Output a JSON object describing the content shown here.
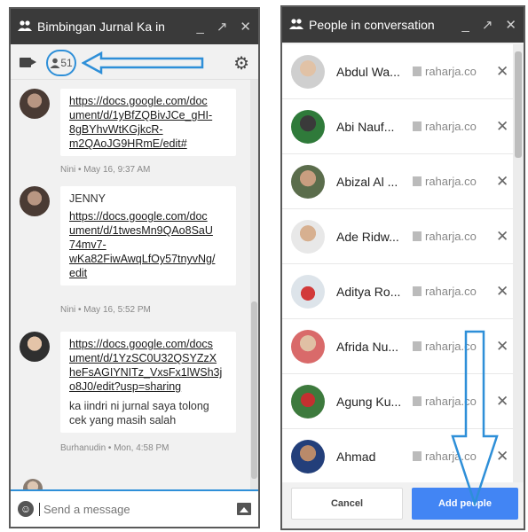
{
  "colors": {
    "titlebar": "#3a3a3a",
    "accent": "#2e8fd8",
    "add_button": "#4285f4"
  },
  "chat": {
    "title": "Bimbingan Jurnal Ka in",
    "people_count": "51",
    "messages": [
      {
        "lines": [
          "https://docs.google.com/doc",
          "ument/d/1yBfZQBivJCe_gHI-",
          "8gBYhvWtKGjkcR-",
          "m2QAoJG9HRmE/edit#"
        ],
        "meta": "Nini • May 16, 9:37 AM"
      },
      {
        "sender": "JENNY",
        "lines": [
          "https://docs.google.com/doc",
          "ument/d/1twesMn9QAo8SaU",
          "74mv7-",
          "wKa82FiwAwqLfOy57tnyvNg/",
          "edit"
        ],
        "meta": "Nini • May 16, 5:52 PM"
      },
      {
        "lines": [
          "https://docs.google.com/docs",
          "ument/d/1YzSC0U32QSYZzX",
          "heFsAGIYNITz_VxsFx1lWSh3j",
          "o8J0/edit?usp=sharing"
        ],
        "text": [
          "ka iindri ni jurnal saya tolong",
          "cek yang masih salah"
        ],
        "meta": "Burhanudin • Mon, 4:58 PM"
      }
    ],
    "composer_placeholder": "Send a message"
  },
  "people": {
    "title": "People in conversation",
    "org": "raharja.co",
    "members": [
      {
        "name": "Abdul Wa..."
      },
      {
        "name": "Abi Nauf..."
      },
      {
        "name": "Abizal Al ..."
      },
      {
        "name": "Ade Ridw..."
      },
      {
        "name": "Aditya Ro..."
      },
      {
        "name": "Afrida Nu..."
      },
      {
        "name": "Agung Ku..."
      },
      {
        "name": "Ahmad"
      }
    ],
    "cancel_label": "Cancel",
    "add_label": "Add people"
  },
  "icons": [
    "people-icon",
    "video-icon",
    "gear-icon",
    "smiley-icon",
    "image-icon",
    "close-icon",
    "building-icon"
  ]
}
